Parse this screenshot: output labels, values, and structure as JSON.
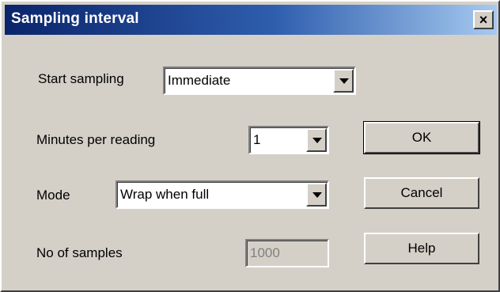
{
  "window": {
    "title": "Sampling interval",
    "close_label": "×"
  },
  "form": {
    "start_sampling": {
      "label": "Start sampling",
      "value": "Immediate"
    },
    "minutes_per_reading": {
      "label": "Minutes per reading",
      "value": "1"
    },
    "mode": {
      "label": "Mode",
      "value": "Wrap when full"
    },
    "no_of_samples": {
      "label": "No of samples",
      "value": "1000"
    }
  },
  "buttons": {
    "ok": "OK",
    "cancel": "Cancel",
    "help": "Help"
  }
}
